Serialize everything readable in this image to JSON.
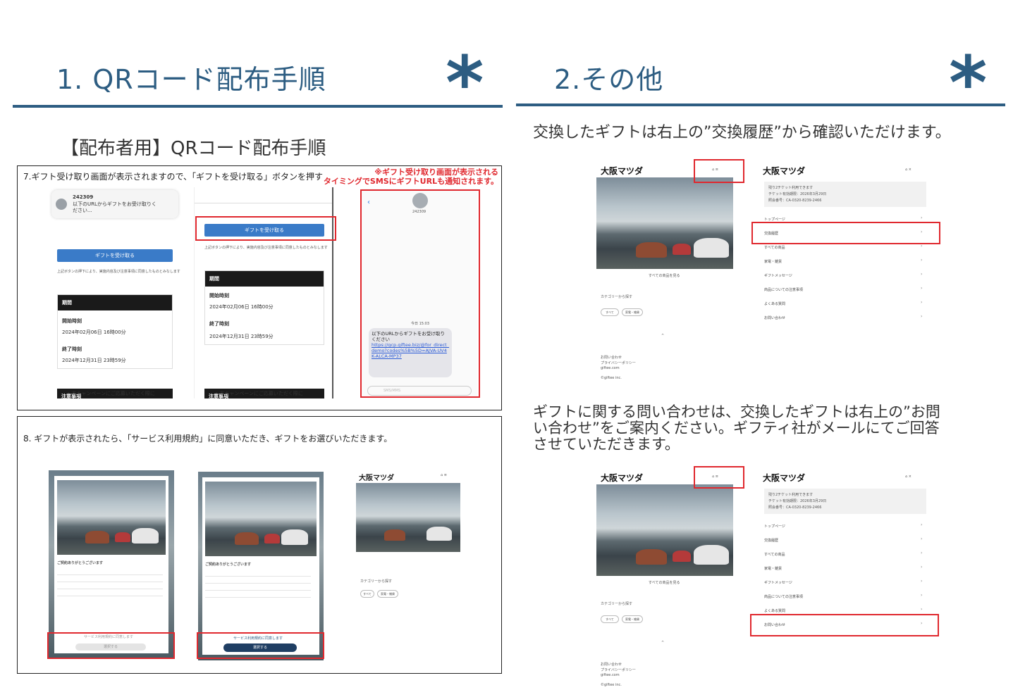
{
  "left": {
    "heading": "1. QRコード配布手順",
    "subheading": "【配布者用】QRコード配布手順",
    "step7": {
      "title": "7.ギフト受け取り画面が表示されますので、「ギフトを受け取る」ボタンを押す",
      "note1": "※ギフト受け取り画面が表示される",
      "note2": "タイミングでSMSにギフトURLも通知されます。",
      "notif_code": "242309",
      "notif_text": "以下のURLからギフトをお受け取りください...",
      "receive_button": "ギフトを受け取る",
      "consent_text": "上記ボタンの押下により、実施内容及び注意事項に同意したものとみなします",
      "period_label": "期間",
      "start_label": "開始時刻",
      "start_value": "2024年02月06日 16時00分",
      "end_label": "終了時刻",
      "end_value": "2024年12月31日 23時59分",
      "notes_label": "注意事項",
      "notes_item": "• 本キャンペーンにご応募いただく際に",
      "sms_sender": "242309",
      "sms_date": "今日 15:03",
      "sms_text": "以下のURLからギフトをお受け取りください",
      "sms_link": "https://gcp.giftee.biz/@for_direct_demo?codes%5B%5D=AJVA-UV4K-ALCA-MP37",
      "sms_placeholder": "SMS/MMS"
    },
    "step8": {
      "title": "8. ギフトが表示されたら、「サービス利用規約」に同意いただき、ギフトをお選びいただきます。",
      "thanks": "ご契約ありがとうございます",
      "agree": "サービス利用規約に同意します",
      "choose_button": "選択する",
      "brand": "大阪マツダ",
      "category": "カテゴリーから探す",
      "cat_all": "すべて",
      "cat_home": "家電・雑貨"
    }
  },
  "right": {
    "heading": "2.その他",
    "para1": "交換したギフトは右上の”交換履歴”から確認いただけます。",
    "para2_line1": "ギフトに関する問い合わせは、交換したギフトは右上の”お問",
    "para2_line2": "い合わせ”をご案内ください。ギフティ社がメールにてご回答",
    "para2_line3": "させていただきます。",
    "brand": "大阪マツダ",
    "ticket_line1": "残り2チケット利用できます",
    "ticket_line2": "チケット有効期限：2026年3月29日",
    "ticket_line3": "照会番号：CA-0320-8239-2466",
    "menu": [
      "トップページ",
      "交換履歴",
      "すべての商品",
      "家電・雑貨",
      "ギフトメッセージ",
      "商品についての注意事項",
      "よくある質問",
      "お問い合わせ"
    ],
    "view_all": "すべての商品を見る",
    "category": "カテゴリーから探す",
    "cat_all": "すべて",
    "cat_home": "家電・雑貨",
    "footer1": "お問い合わせ",
    "footer2": "プライバシーポリシー",
    "footer3": "giftee.com",
    "footer4": "©giftee inc."
  },
  "colors": {
    "accent": "#2d5d82",
    "highlight": "#e0282e",
    "button": "#3a7bc8"
  }
}
